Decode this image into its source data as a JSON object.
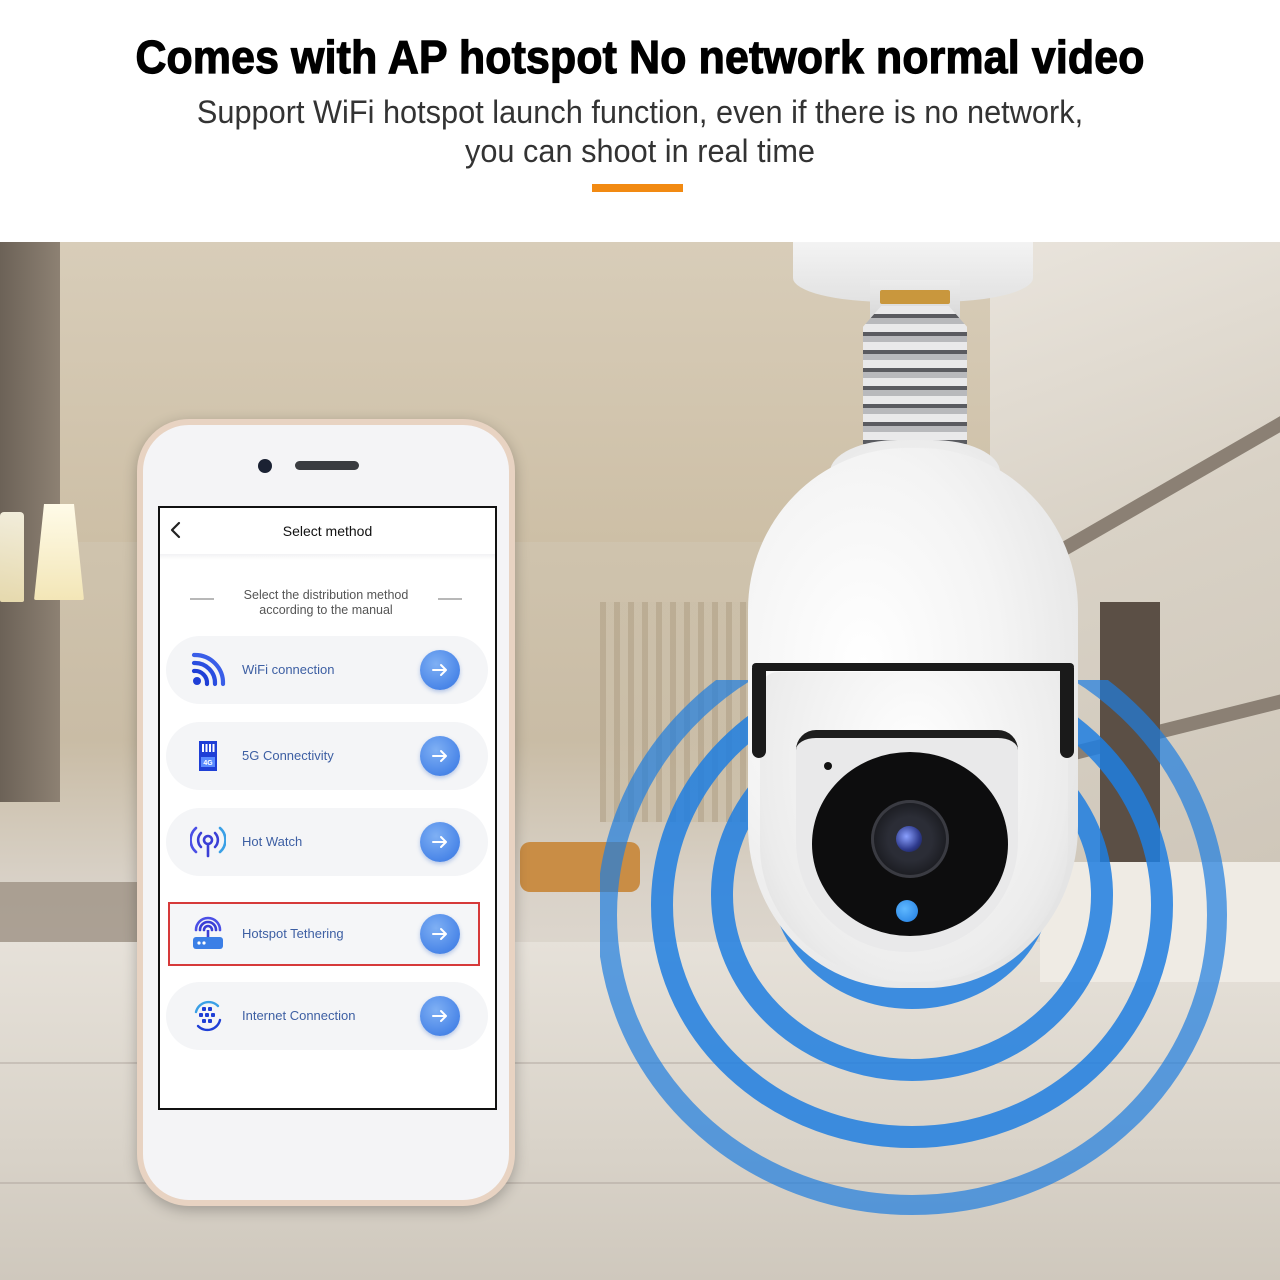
{
  "header": {
    "headline": "Comes with AP hotspot No network normal video",
    "subtitle_line1": "Support WiFi hotspot launch function, even if there is no network,",
    "subtitle_line2": "you can shoot in real time",
    "accent_color": "#f28a12"
  },
  "phone_app": {
    "nav": {
      "back_icon": "chevron-left-icon",
      "title": "Select method"
    },
    "hint_line1": "Select the distribution method",
    "hint_line2": "according to the manual",
    "options": [
      {
        "label": "WiFi connection",
        "icon": "wifi-icon",
        "selected": false
      },
      {
        "label": "5G Connectivity",
        "icon": "sim-card-4g-icon",
        "selected": false
      },
      {
        "label": "Hot Watch",
        "icon": "signal-broadcast-icon",
        "selected": false
      },
      {
        "label": "Hotspot Tethering",
        "icon": "router-hotspot-icon",
        "selected": true
      },
      {
        "label": "Internet Connection",
        "icon": "globe-sync-icon",
        "selected": false
      }
    ],
    "arrow_icon": "arrow-right-icon",
    "colors": {
      "option_text": "#3d5fa3",
      "arrow_button": "#4a86e8",
      "highlight_border": "#d63a3a",
      "icon_blue": "#1f3fd6"
    }
  },
  "product": {
    "name": "bulb-camera",
    "signal_wave_color": "#1e7ee0"
  }
}
